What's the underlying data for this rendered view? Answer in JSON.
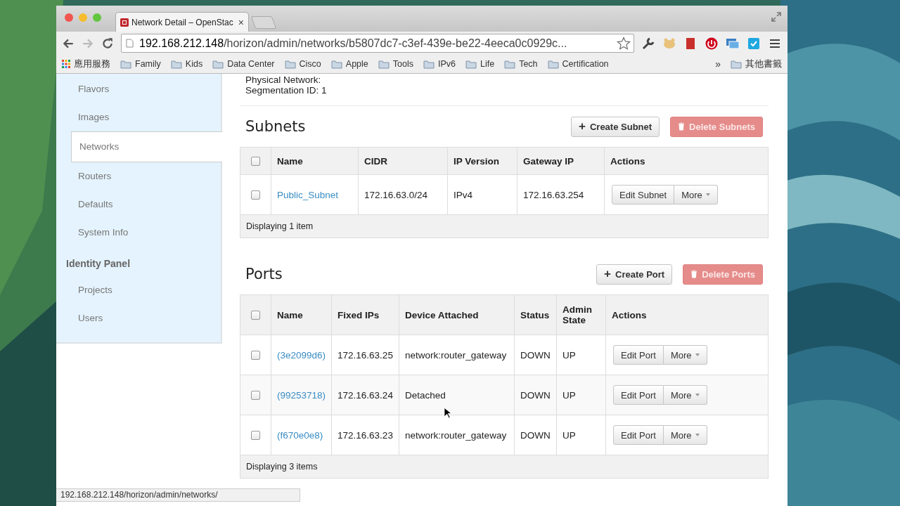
{
  "browser": {
    "tab_title": "Network Detail – OpenStac",
    "tab_close": "×",
    "url_host": "192.168.212.148",
    "url_path": "/horizon/admin/networks/b5807dc7-c3ef-439e-be22-4eeca0c0929c...",
    "forward_disabled": true
  },
  "bookmarks": {
    "apps_label": "應用服務",
    "items": [
      "Family",
      "Kids",
      "Data Center",
      "Cisco",
      "Apple",
      "Tools",
      "IPv6",
      "Life",
      "Tech",
      "Certification"
    ],
    "overflow": "»",
    "other": "其他書籤"
  },
  "sidebar": {
    "items": [
      {
        "kind": "item",
        "label": "Flavors",
        "selected": false
      },
      {
        "kind": "item",
        "label": "Images",
        "selected": false
      },
      {
        "kind": "item",
        "label": "Networks",
        "selected": true
      },
      {
        "kind": "item",
        "label": "Routers",
        "selected": false
      },
      {
        "kind": "item",
        "label": "Defaults",
        "selected": false
      },
      {
        "kind": "item",
        "label": "System Info",
        "selected": false
      },
      {
        "kind": "header",
        "label": "Identity Panel"
      },
      {
        "kind": "item",
        "label": "Projects",
        "selected": false
      },
      {
        "kind": "item",
        "label": "Users",
        "selected": false
      }
    ]
  },
  "details": [
    "Physical Network:",
    "Segmentation ID: 1"
  ],
  "subnets": {
    "title": "Subnets",
    "create_button": {
      "icon": "+",
      "label": "Create Subnet"
    },
    "delete_button": {
      "label": "Delete Subnets",
      "disabled": true
    },
    "select_all_checked": false,
    "columns": [
      "Name",
      "CIDR",
      "IP Version",
      "Gateway IP",
      "Actions"
    ],
    "rows": [
      {
        "checked": false,
        "cells": [
          "Public_Subnet",
          "172.16.63.0/24",
          "IPv4",
          "172.16.63.254"
        ],
        "edit": "Edit Subnet",
        "more": "More"
      }
    ],
    "footer": "Displaying 1 item"
  },
  "ports": {
    "title": "Ports",
    "create_button": {
      "icon": "+",
      "label": "Create Port"
    },
    "delete_button": {
      "label": "Delete Ports",
      "disabled": true
    },
    "select_all_checked": false,
    "columns": [
      "Name",
      "Fixed IPs",
      "Device Attached",
      "Status",
      "Admin State",
      "Actions"
    ],
    "rows": [
      {
        "checked": false,
        "cells": [
          "(3e2099d6)",
          "172.16.63.25",
          "network:router_gateway",
          "DOWN",
          "UP"
        ],
        "edit": "Edit Port",
        "more": "More"
      },
      {
        "checked": false,
        "cells": [
          "(99253718)",
          "172.16.63.24",
          "Detached",
          "DOWN",
          "UP"
        ],
        "edit": "Edit Port",
        "more": "More"
      },
      {
        "checked": false,
        "cells": [
          "(f670e0e8)",
          "172.16.63.23",
          "network:router_gateway",
          "DOWN",
          "UP"
        ],
        "edit": "Edit Port",
        "more": "More"
      }
    ],
    "footer": "Displaying 3 items"
  },
  "status_bar": "192.168.212.148/horizon/admin/networks/"
}
